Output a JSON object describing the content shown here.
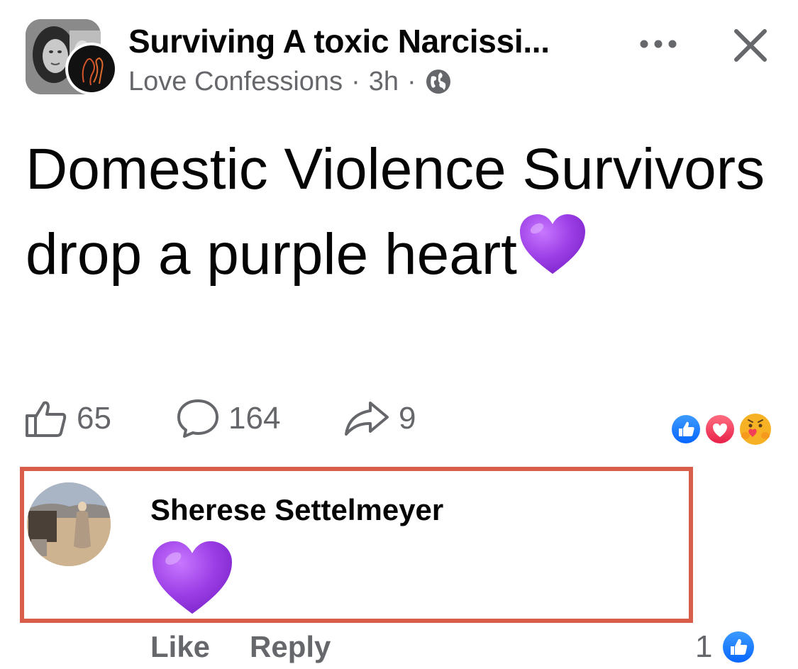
{
  "post": {
    "title": "Surviving A toxic Narcissi...",
    "author": "Love Confessions",
    "time": "3h",
    "separator": "·",
    "text": "Domestic Violence Survivors drop a purple heart",
    "emoji": "purple-heart"
  },
  "header": {
    "more_icon": "more-horizontal-icon",
    "close_icon": "close-icon",
    "audience_icon": "globe-icon"
  },
  "stats": {
    "likes": "65",
    "comments": "164",
    "shares": "9",
    "reactions": [
      "like",
      "love",
      "care"
    ]
  },
  "comment": {
    "author": "Sherese Settelmeyer",
    "content_emoji": "purple-heart",
    "like_label": "Like",
    "reply_label": "Reply",
    "like_count": "1"
  },
  "colors": {
    "highlight_border": "#d85d4a",
    "secondary_text": "#65676b",
    "facebook_blue": "#1877f2",
    "love_red": "#f33e58",
    "purple_heart": "#a33fe8"
  }
}
